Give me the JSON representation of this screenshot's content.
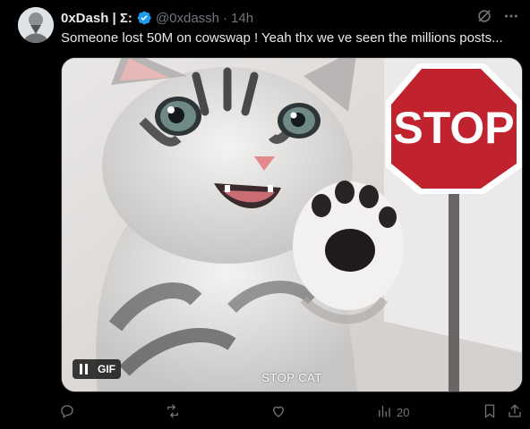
{
  "tweet": {
    "author_name": "0xDash | Σ:",
    "handle": "@0xdassh",
    "separator": "·",
    "time": "14h",
    "text": "Someone lost 50M on cowswap ! Yeah thx we ve seen the millions posts..."
  },
  "media": {
    "gif_label": "GIF",
    "caption": "STOP CAT",
    "sign_text": "STOP"
  },
  "actions": {
    "views_count": "20"
  },
  "colors": {
    "background": "#000000",
    "text": "#e7e9ea",
    "muted": "#71767b",
    "verified": "#1d9bf0",
    "stop_sign": "#c0232d"
  },
  "icons": {
    "verified": "verified-badge-icon",
    "grok": "grok-icon",
    "more": "more-dots-icon",
    "reply": "reply-icon",
    "retweet": "retweet-icon",
    "like": "like-icon",
    "views": "views-icon",
    "bookmark": "bookmark-icon",
    "share": "share-icon",
    "pause": "pause-icon"
  }
}
